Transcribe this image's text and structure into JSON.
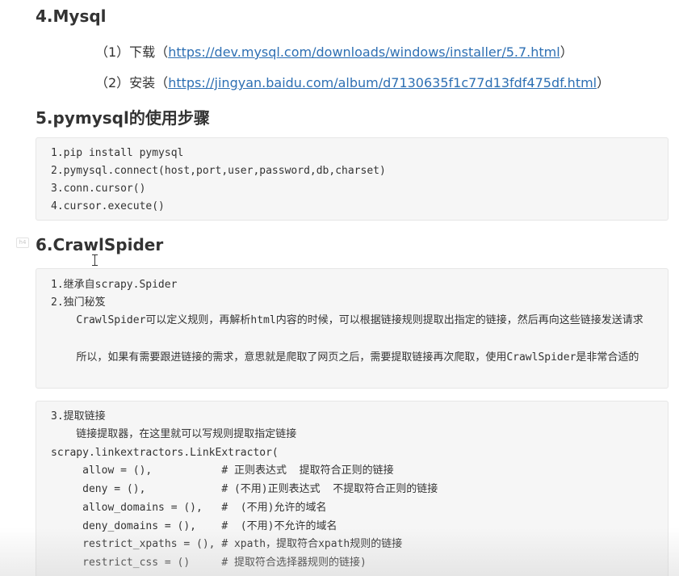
{
  "section4": {
    "heading": "4.Mysql",
    "items": [
      {
        "prefix": "（1）下载（",
        "link": "https://dev.mysql.com/downloads/windows/installer/5.7.html",
        "suffix": "）"
      },
      {
        "prefix": "（2）安装（",
        "link": "https://jingyan.baidu.com/album/d7130635f1c77d13fdf475df.html",
        "suffix": "）"
      }
    ]
  },
  "section5": {
    "heading": "5.pymysql的使用步骤",
    "code": [
      "1.pip install pymysql",
      "2.pymysql.connect(host,port,user,password,db,charset)",
      "3.conn.cursor()",
      "4.cursor.execute()"
    ]
  },
  "section6": {
    "badge": "h4",
    "heading": "6.CrawlSpider",
    "code1": [
      "1.继承自scrapy.Spider",
      "2.独门秘笈",
      "    CrawlSpider可以定义规则，再解析html内容的时候，可以根据链接规则提取出指定的链接，然后再向这些链接发送请求",
      "    所以，如果有需要跟进链接的需求，意思就是爬取了网页之后，需要提取链接再次爬取，使用CrawlSpider是非常合适的"
    ],
    "code2": [
      "3.提取链接",
      "    链接提取器，在这里就可以写规则提取指定链接",
      "scrapy.linkextractors.LinkExtractor(",
      "     allow = (),           # 正则表达式  提取符合正则的链接",
      "     deny = (),            # (不用)正则表达式  不提取符合正则的链接",
      "     allow_domains = (),   #  (不用)允许的域名",
      "     deny_domains = (),    #  (不用)不允许的域名",
      "     restrict_xpaths = (), # xpath，提取符合xpath规则的链接",
      "     restrict_css = ()     # 提取符合选择器规则的链接)"
    ]
  }
}
